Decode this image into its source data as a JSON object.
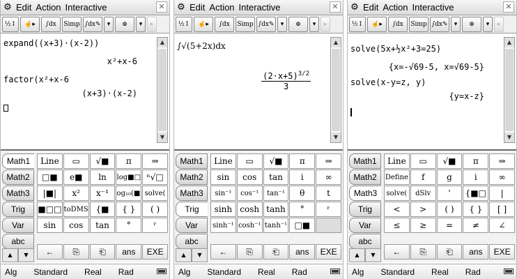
{
  "menu": {
    "edit": "Edit",
    "action": "Action",
    "interactive": "Interactive",
    "close": "✕"
  },
  "toolbar": {
    "simp": "Simp"
  },
  "panels": [
    {
      "input1": "expand((x+3)·(x-2))",
      "result1": "x²+x-6",
      "input2": "factor(x²+x-6",
      "result2": "(x+3)·(x-2)"
    },
    {
      "input1": "∫√(5+2x)dx",
      "result_num": "(2·x+5)",
      "result_exp": "3/2",
      "result_den": "3"
    },
    {
      "input1": "solve(5x+½x²+3=25)",
      "result1": "{x=-√69-5, x=√69-5}",
      "input2": "solve(x-y=z, y)",
      "result2": "{y=x-z}"
    }
  ],
  "tabs": [
    "Math1",
    "Math2",
    "Math3",
    "Trig",
    "Var",
    "abc"
  ],
  "keys_math1": [
    "Line",
    "▭",
    "√■",
    "π",
    "⇒",
    "□■",
    "e■",
    "ln",
    "log■□",
    "ⁿ√□",
    "|■|",
    "x²",
    "x⁻¹",
    "log₁₀(■)",
    "solve(",
    "■□□",
    "toDMS",
    "{■",
    "{ }",
    "( )",
    "sin",
    "cos",
    "tan",
    "°",
    "ʳ"
  ],
  "keys_trig": [
    "Line",
    "▭",
    "√■",
    "π",
    "⇒",
    "sin",
    "cos",
    "tan",
    "i",
    "∞",
    "sin⁻¹",
    "cos⁻¹",
    "tan⁻¹",
    "θ",
    "t",
    "sinh",
    "cosh",
    "tanh",
    "°",
    "ʳ",
    "sinh⁻¹",
    "cosh⁻¹",
    "tanh⁻¹",
    "□■",
    ""
  ],
  "keys_math3": [
    "Line",
    "▭",
    "√■",
    "π",
    "⇒",
    "Define",
    "f",
    "g",
    "i",
    "∞",
    "solve(",
    "dSlv",
    "'",
    "{■□",
    "|",
    "<",
    ">",
    "( )",
    "{ }",
    "[ ]",
    "≤",
    "≥",
    "=",
    "≠",
    "∠"
  ],
  "bottom_keys": [
    "←",
    "⎘",
    "⎗",
    "ans",
    "EXE"
  ],
  "status": {
    "mode": "Alg",
    "format": "Standard",
    "real": "Real",
    "angle": "Rad"
  }
}
